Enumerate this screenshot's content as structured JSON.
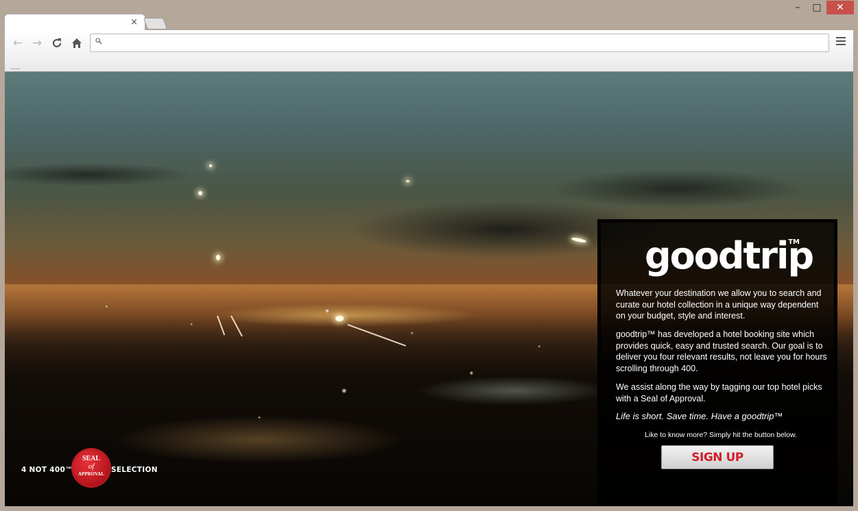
{
  "browser": {
    "tab_close_glyph": "×",
    "omnibox_value": "",
    "omnibox_placeholder": ""
  },
  "window_controls": {
    "minimize": "–",
    "maximize": "□",
    "close": "✕"
  },
  "panel": {
    "logo": "goodtrip",
    "logo_tm": "TM",
    "para1": "Whatever your destination we allow you to search and curate our hotel collection in a unique way dependent on your budget, style and interest.",
    "para2": "goodtrip™ has developed a hotel booking site which provides quick, easy and trusted search. Our goal is to deliver you four relevant results, not leave you for hours scrolling through 400.",
    "para3": "We assist along the way by tagging our top hotel picks with a Seal of Approval.",
    "tagline": "Life is short. Save time. Have a goodtrip™",
    "cta_text": "Like to know more? Simply hit the button below.",
    "signup_label": "SIGN UP"
  },
  "seal_badge": {
    "left_text": "4 NOT 400™",
    "seal_line1": "SEAL",
    "seal_line2": "of",
    "seal_line3": "APPROVAL",
    "right_text": "SELECTION"
  },
  "colors": {
    "accent_red": "#d11f2a",
    "window_frame": "#b5a79a",
    "close_button": "#c7504a"
  }
}
